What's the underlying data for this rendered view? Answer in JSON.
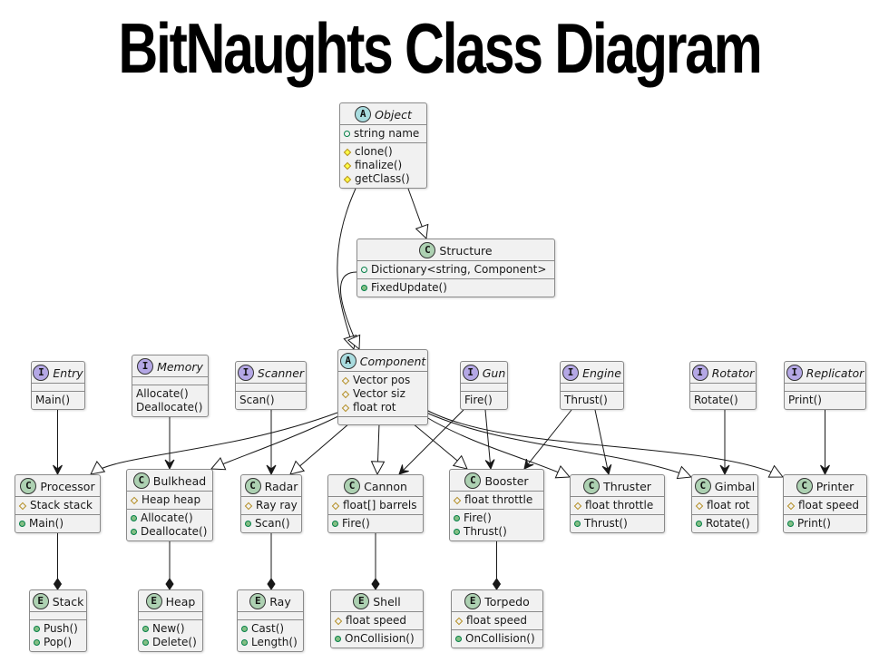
{
  "title": "BitNaughts Class Diagram",
  "colors": {
    "abstract_badge": "#a9dcdf",
    "interface_badge": "#b4a7e5",
    "class_badge": "#add1b2",
    "enum_badge": "#add1b2",
    "box_fill": "#f1f1f1",
    "box_border": "#8a8a8a",
    "line": "#181818"
  },
  "classes": [
    {
      "id": "Object",
      "stereotype": "A",
      "name": "Object",
      "italic": true,
      "fields": [
        {
          "vis": "public-field",
          "text": "string name"
        }
      ],
      "methods": [
        {
          "vis": "protected-method",
          "text": "clone()"
        },
        {
          "vis": "protected-method",
          "text": "finalize()"
        },
        {
          "vis": "protected-method",
          "text": "getClass()"
        }
      ]
    },
    {
      "id": "Structure",
      "stereotype": "C",
      "name": "Structure",
      "italic": false,
      "fields": [
        {
          "vis": "public-field",
          "text": "Dictionary<string, Component>"
        }
      ],
      "methods": [
        {
          "vis": "public-method",
          "text": "FixedUpdate()"
        }
      ]
    },
    {
      "id": "Component",
      "stereotype": "A",
      "name": "Component",
      "italic": true,
      "fields": [
        {
          "vis": "protected-field",
          "text": "Vector pos"
        },
        {
          "vis": "protected-field",
          "text": "Vector siz"
        },
        {
          "vis": "protected-field",
          "text": "float rot"
        }
      ],
      "methods": []
    },
    {
      "id": "Entry",
      "stereotype": "I",
      "name": "Entry",
      "italic": true,
      "fields": [],
      "methods": [
        {
          "vis": "none",
          "text": "Main()"
        }
      ]
    },
    {
      "id": "Memory",
      "stereotype": "I",
      "name": "Memory",
      "italic": true,
      "fields": [],
      "methods": [
        {
          "vis": "none",
          "text": "Allocate()"
        },
        {
          "vis": "none",
          "text": "Deallocate()"
        }
      ]
    },
    {
      "id": "Scanner",
      "stereotype": "I",
      "name": "Scanner",
      "italic": true,
      "fields": [],
      "methods": [
        {
          "vis": "none",
          "text": "Scan()"
        }
      ]
    },
    {
      "id": "Gun",
      "stereotype": "I",
      "name": "Gun",
      "italic": true,
      "fields": [],
      "methods": [
        {
          "vis": "none",
          "text": "Fire()"
        }
      ]
    },
    {
      "id": "Engine",
      "stereotype": "I",
      "name": "Engine",
      "italic": true,
      "fields": [],
      "methods": [
        {
          "vis": "none",
          "text": "Thrust()"
        }
      ]
    },
    {
      "id": "Rotator",
      "stereotype": "I",
      "name": "Rotator",
      "italic": true,
      "fields": [],
      "methods": [
        {
          "vis": "none",
          "text": "Rotate()"
        }
      ]
    },
    {
      "id": "Replicator",
      "stereotype": "I",
      "name": "Replicator",
      "italic": true,
      "fields": [],
      "methods": [
        {
          "vis": "none",
          "text": "Print()"
        }
      ]
    },
    {
      "id": "Processor",
      "stereotype": "C",
      "name": "Processor",
      "italic": false,
      "fields": [
        {
          "vis": "protected-field",
          "text": "Stack stack"
        }
      ],
      "methods": [
        {
          "vis": "public-method",
          "text": "Main()"
        }
      ]
    },
    {
      "id": "Bulkhead",
      "stereotype": "C",
      "name": "Bulkhead",
      "italic": false,
      "fields": [
        {
          "vis": "protected-field",
          "text": "Heap heap"
        }
      ],
      "methods": [
        {
          "vis": "public-method",
          "text": "Allocate()"
        },
        {
          "vis": "public-method",
          "text": "Deallocate()"
        }
      ]
    },
    {
      "id": "Radar",
      "stereotype": "C",
      "name": "Radar",
      "italic": false,
      "fields": [
        {
          "vis": "protected-field",
          "text": "Ray ray"
        }
      ],
      "methods": [
        {
          "vis": "public-method",
          "text": "Scan()"
        }
      ]
    },
    {
      "id": "Cannon",
      "stereotype": "C",
      "name": "Cannon",
      "italic": false,
      "fields": [
        {
          "vis": "protected-field",
          "text": "float[] barrels"
        }
      ],
      "methods": [
        {
          "vis": "public-method",
          "text": "Fire()"
        }
      ]
    },
    {
      "id": "Booster",
      "stereotype": "C",
      "name": "Booster",
      "italic": false,
      "fields": [
        {
          "vis": "protected-field",
          "text": "float throttle"
        }
      ],
      "methods": [
        {
          "vis": "public-method",
          "text": "Fire()"
        },
        {
          "vis": "public-method",
          "text": "Thrust()"
        }
      ]
    },
    {
      "id": "Thruster",
      "stereotype": "C",
      "name": "Thruster",
      "italic": false,
      "fields": [
        {
          "vis": "protected-field",
          "text": "float throttle"
        }
      ],
      "methods": [
        {
          "vis": "public-method",
          "text": "Thrust()"
        }
      ]
    },
    {
      "id": "Gimbal",
      "stereotype": "C",
      "name": "Gimbal",
      "italic": false,
      "fields": [
        {
          "vis": "protected-field",
          "text": "float rot"
        }
      ],
      "methods": [
        {
          "vis": "public-method",
          "text": "Rotate()"
        }
      ]
    },
    {
      "id": "Printer",
      "stereotype": "C",
      "name": "Printer",
      "italic": false,
      "fields": [
        {
          "vis": "protected-field",
          "text": "float speed"
        }
      ],
      "methods": [
        {
          "vis": "public-method",
          "text": "Print()"
        }
      ]
    },
    {
      "id": "Stack",
      "stereotype": "E",
      "name": "Stack",
      "italic": false,
      "fields": [],
      "methods": [
        {
          "vis": "public-method",
          "text": "Push()"
        },
        {
          "vis": "public-method",
          "text": "Pop()"
        }
      ]
    },
    {
      "id": "Heap",
      "stereotype": "E",
      "name": "Heap",
      "italic": false,
      "fields": [],
      "methods": [
        {
          "vis": "public-method",
          "text": "New()"
        },
        {
          "vis": "public-method",
          "text": "Delete()"
        }
      ]
    },
    {
      "id": "Ray",
      "stereotype": "E",
      "name": "Ray",
      "italic": false,
      "fields": [],
      "methods": [
        {
          "vis": "public-method",
          "text": "Cast()"
        },
        {
          "vis": "public-method",
          "text": "Length()"
        }
      ]
    },
    {
      "id": "Shell",
      "stereotype": "E",
      "name": "Shell",
      "italic": false,
      "fields": [
        {
          "vis": "protected-field",
          "text": "float speed"
        }
      ],
      "methods": [
        {
          "vis": "public-method",
          "text": "OnCollision()"
        }
      ]
    },
    {
      "id": "Torpedo",
      "stereotype": "E",
      "name": "Torpedo",
      "italic": false,
      "fields": [
        {
          "vis": "protected-field",
          "text": "float speed"
        }
      ],
      "methods": [
        {
          "vis": "public-method",
          "text": "OnCollision()"
        }
      ]
    }
  ],
  "relations": [
    {
      "from": "Object",
      "to": "Structure",
      "type": "extends"
    },
    {
      "from": "Object",
      "to": "Component",
      "type": "extends"
    },
    {
      "from": "Structure",
      "to": "Component",
      "type": "extends"
    },
    {
      "from": "Component",
      "to": "Processor",
      "type": "extends"
    },
    {
      "from": "Component",
      "to": "Bulkhead",
      "type": "extends"
    },
    {
      "from": "Component",
      "to": "Radar",
      "type": "extends"
    },
    {
      "from": "Component",
      "to": "Cannon",
      "type": "extends"
    },
    {
      "from": "Component",
      "to": "Booster",
      "type": "extends"
    },
    {
      "from": "Component",
      "to": "Thruster",
      "type": "extends"
    },
    {
      "from": "Component",
      "to": "Gimbal",
      "type": "extends"
    },
    {
      "from": "Component",
      "to": "Printer",
      "type": "extends"
    },
    {
      "from": "Entry",
      "to": "Processor",
      "type": "implements"
    },
    {
      "from": "Memory",
      "to": "Bulkhead",
      "type": "implements"
    },
    {
      "from": "Scanner",
      "to": "Radar",
      "type": "implements"
    },
    {
      "from": "Gun",
      "to": "Cannon",
      "type": "implements"
    },
    {
      "from": "Gun",
      "to": "Booster",
      "type": "implements"
    },
    {
      "from": "Engine",
      "to": "Booster",
      "type": "implements"
    },
    {
      "from": "Engine",
      "to": "Thruster",
      "type": "implements"
    },
    {
      "from": "Rotator",
      "to": "Gimbal",
      "type": "implements"
    },
    {
      "from": "Replicator",
      "to": "Printer",
      "type": "implements"
    },
    {
      "from": "Processor",
      "to": "Stack",
      "type": "composition"
    },
    {
      "from": "Bulkhead",
      "to": "Heap",
      "type": "composition"
    },
    {
      "from": "Radar",
      "to": "Ray",
      "type": "composition"
    },
    {
      "from": "Cannon",
      "to": "Shell",
      "type": "composition"
    },
    {
      "from": "Booster",
      "to": "Torpedo",
      "type": "composition"
    }
  ]
}
